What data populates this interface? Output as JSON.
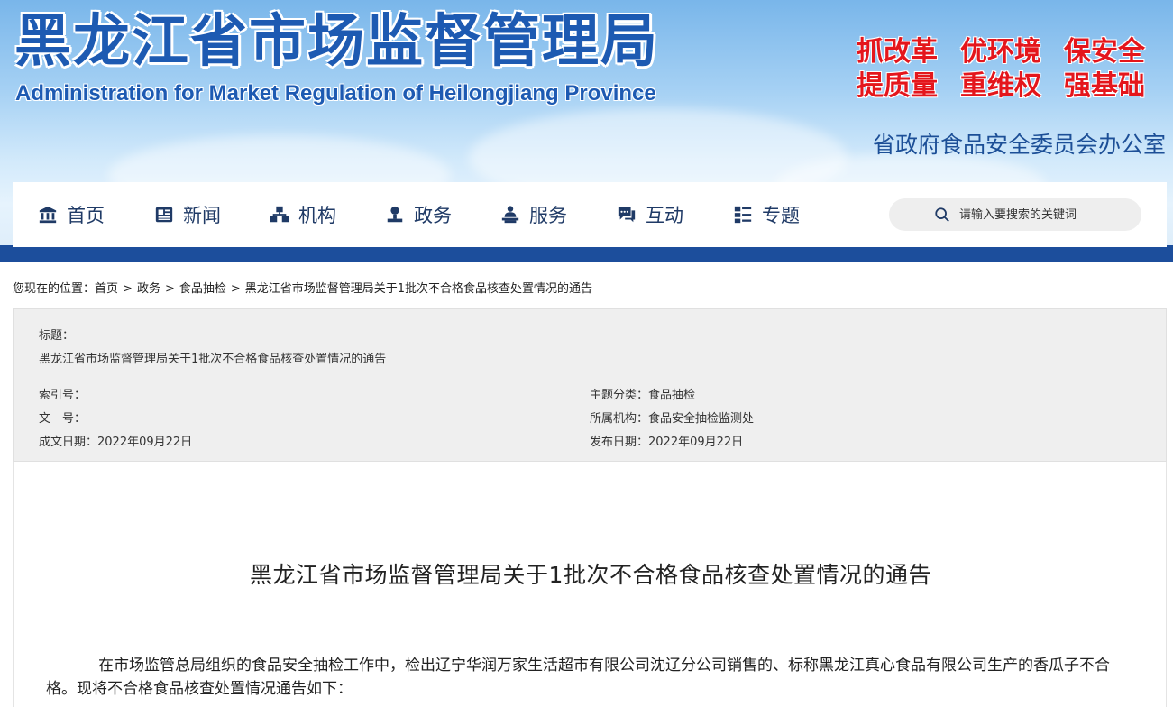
{
  "header": {
    "title": "黑龙江省市场监督管理局",
    "subtitle": "Administration for Market Regulation of Heilongjiang Province",
    "slogans": [
      "抓改革",
      "优环境",
      "保安全",
      "提质量",
      "重维权",
      "强基础"
    ],
    "office": "省政府食品安全委员会办公室"
  },
  "nav": {
    "items": [
      {
        "label": "首页",
        "icon": "home-icon"
      },
      {
        "label": "新闻",
        "icon": "news-icon"
      },
      {
        "label": "机构",
        "icon": "org-icon"
      },
      {
        "label": "政务",
        "icon": "affairs-icon"
      },
      {
        "label": "服务",
        "icon": "service-icon"
      },
      {
        "label": "互动",
        "icon": "chat-icon"
      },
      {
        "label": "专题",
        "icon": "topic-icon"
      }
    ],
    "search_placeholder": "请输入要搜索的关键词"
  },
  "breadcrumb": {
    "prefix": "您现在的位置：",
    "items": [
      "首页",
      "政务",
      "食品抽检",
      "黑龙江省市场监督管理局关于1批次不合格食品核查处置情况的通告"
    ],
    "separator": ">"
  },
  "meta": {
    "title_label": "标题：",
    "title_value": "黑龙江省市场监督管理局关于1批次不合格食品核查处置情况的通告",
    "index_label": "索引号：",
    "index_value": "",
    "doc_label": "文　号：",
    "doc_value": "",
    "created_label": "成文日期：",
    "created_value": "2022年09月22日",
    "category_label": "主题分类：",
    "category_value": "食品抽检",
    "org_label": "所属机构：",
    "org_value": "食品安全抽检监测处",
    "published_label": "发布日期：",
    "published_value": "2022年09月22日"
  },
  "article": {
    "title": "黑龙江省市场监督管理局关于1批次不合格食品核查处置情况的通告",
    "paragraph": "在市场监管总局组织的食品安全抽检工作中，检出辽宁华润万家生活超市有限公司沈辽分公司销售的、标称黑龙江真心食品有限公司生产的香瓜子不合格。现将不合格食品核查处置情况通告如下："
  },
  "colors": {
    "brand_blue": "#1d5ab2",
    "nav_band": "#1c4e9c",
    "slogan_red": "#e4161c"
  }
}
